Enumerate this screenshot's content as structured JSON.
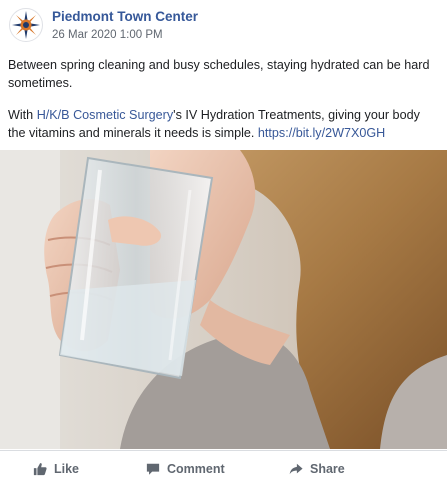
{
  "post": {
    "page_name": "Piedmont Town Center",
    "timestamp": "26 Mar 2020 1:00 PM",
    "para1": "Between spring cleaning and busy schedules, staying hydrated can be hard sometimes.",
    "para2_prefix": "With ",
    "para2_link": "H/K/B Cosmetic Surgery",
    "para2_middle": "'s IV Hydration Treatments, giving your body the vitamins and minerals it needs is simple. ",
    "para2_url": "https://bit.ly/2W7X0GH"
  },
  "actions": {
    "like": "Like",
    "comment": "Comment",
    "share": "Share"
  },
  "icons": {
    "avatar": "compass-logo-icon",
    "like": "thumbs-up-icon",
    "comment": "comment-bubble-icon",
    "share": "share-arrow-icon"
  },
  "colors": {
    "page_name": "#365899",
    "link": "#385898",
    "meta": "#606770",
    "text": "#1c1e21"
  }
}
